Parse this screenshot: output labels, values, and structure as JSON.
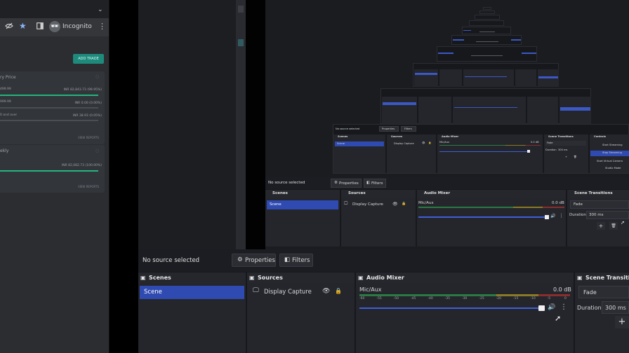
{
  "browser": {
    "incognito_label": "Incognito",
    "incognito_icon": "incognito-icon",
    "icons": [
      "eye-off-icon",
      "star-icon",
      "sidebar-icon",
      "more-vert-icon",
      "chevron-down-icon"
    ]
  },
  "web": {
    "add_trade_label": "ADD TRADE",
    "card1": {
      "title": "ry Price",
      "rows": [
        {
          "label": "499.99",
          "value": "INR 82,843.73 (99.95%)",
          "fill": 0.9995
        },
        {
          "label": "999.99",
          "value": "INR 0.00 (0.00%)",
          "fill": 0.0
        },
        {
          "label": "0 and over",
          "value": "INR 38.93 (0.05%)",
          "fill": 0.0005
        }
      ],
      "view_reports": "VIEW REPORTS"
    },
    "card2": {
      "title": "ekly",
      "rows": [
        {
          "label": "",
          "value": "INR 82,082.73 (100.00%)",
          "fill": 1.0
        }
      ],
      "view_reports": "VIEW REPORTS"
    }
  },
  "obs": {
    "no_source_selected": "No source selected",
    "properties_label": "Properties",
    "filters_label": "Filters",
    "scenes_title": "Scenes",
    "sources_title": "Sources",
    "audio_mixer_title": "Audio Mixer",
    "scene_transitions_title": "Scene Transitions",
    "scene_transitions_title_short": "Scene Transitio",
    "controls_title": "Controls",
    "scene_item": "Scene",
    "source_item": "Display Capture",
    "mic_label": "Mic/Aux",
    "mic_db": "0.0 dB",
    "mic_volume": 0.98,
    "meter_ticks": [
      "-60",
      "-55",
      "-50",
      "-45",
      "-40",
      "-35",
      "-30",
      "-25",
      "-20",
      "-15",
      "-10",
      "-5",
      "0"
    ],
    "transition_value": "Fade",
    "duration_label": "Duration",
    "duration_value": "300 ms",
    "controls": [
      "Start Streaming",
      "Stop Streaming",
      "Start Virtual Camera",
      "Studio Mode"
    ],
    "colors": {
      "selection": "#2f4ab0",
      "panel": "#24262c",
      "background": "#17181c"
    }
  }
}
